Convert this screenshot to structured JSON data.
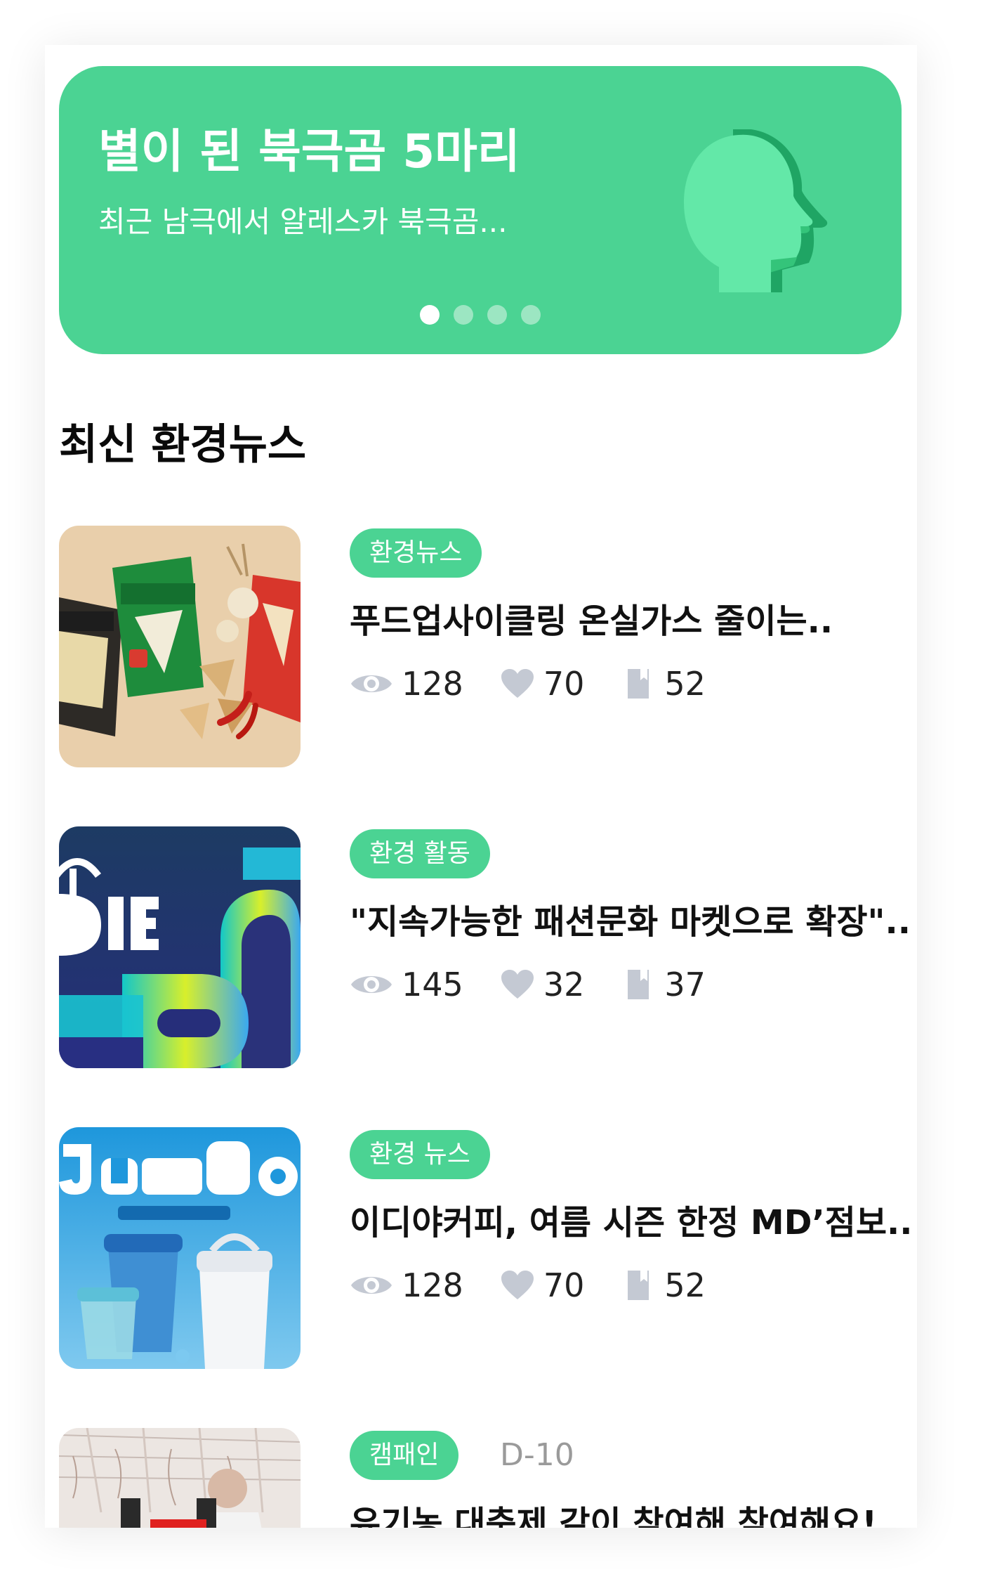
{
  "banner": {
    "title": "별이 된 북극곰 5마리",
    "subtitle": "최근 남극에서 알레스카 북극곰...",
    "icon": "head-silhouette-icon",
    "slide_count": 4,
    "active_slide": 1
  },
  "section_title": "최신 환경뉴스",
  "news": [
    {
      "tag": "환경뉴스",
      "title": "푸드업사이클링 온실가스 줄이는..",
      "views": "128",
      "likes": "70",
      "bookmarks": "52",
      "thumbnail": "snack-chip-photo"
    },
    {
      "tag": "환경 활동",
      "title": "\"지속가능한 패션문화 마켓으로 확장\"..",
      "views": "145",
      "likes": "32",
      "bookmarks": "37",
      "thumbnail": "fashion-code-poster"
    },
    {
      "tag": "환경 뉴스",
      "title": "이디야커피, 여름 시즌 한정 MD’점보..",
      "views": "128",
      "likes": "70",
      "bookmarks": "52",
      "thumbnail": "jumbo-blue-wave-tumbler-ad"
    },
    {
      "tag": "캠패인",
      "dday": "D-10",
      "title": "유기농 대축제 같이 참여해 참여해요!",
      "thumbnail": "greenhouse-farmer-photo"
    }
  ],
  "icons": {
    "views": "eye-icon",
    "likes": "heart-icon",
    "bookmarks": "bookmark-icon"
  },
  "colors": {
    "accent": "#4bd393",
    "accent_dark": "#1fa564",
    "icon_gray": "#c4c9d3"
  }
}
